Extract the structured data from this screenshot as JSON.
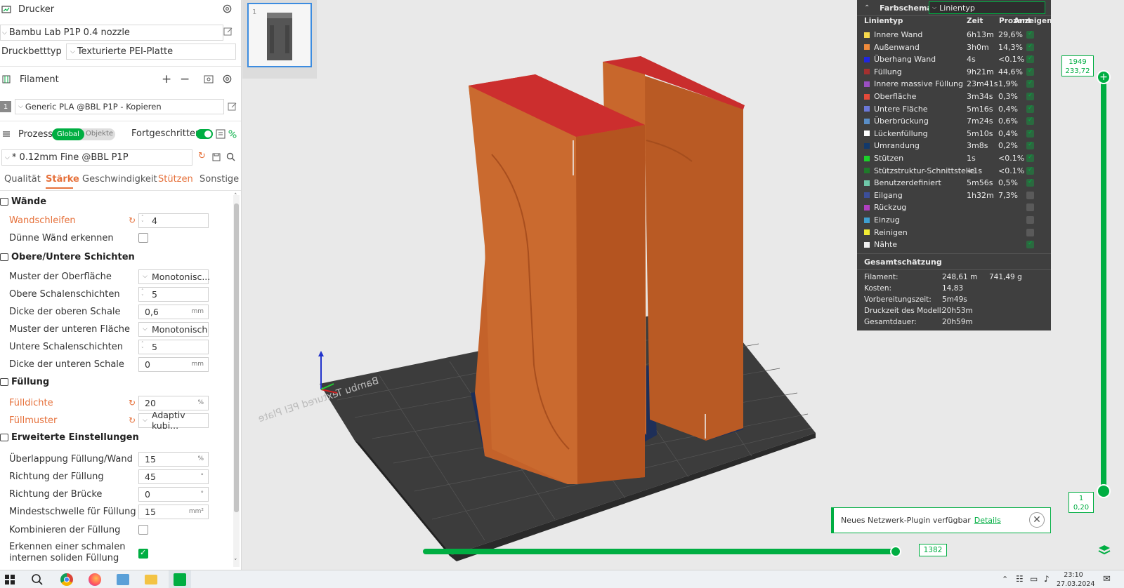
{
  "printer": {
    "section_title": "Drucker",
    "printer_name": "Bambu Lab P1P 0.4 nozzle",
    "bed_type_label": "Druckbetttyp",
    "bed_type_value": "Texturierte PEI-Platte"
  },
  "filament": {
    "section_title": "Filament",
    "slot_number": "1",
    "name": "Generic PLA @BBL P1P - Kopieren"
  },
  "process": {
    "section_title": "Prozess",
    "toggle_global": "Global",
    "toggle_objects": "Objekte",
    "advanced_label": "Fortgeschritten",
    "preset": "* 0.12mm Fine @BBL P1P",
    "tabs": [
      "Qualität",
      "Stärke",
      "Geschwindigkeit",
      "Stützen",
      "Sonstige"
    ],
    "active_tab": "Stärke"
  },
  "settings": {
    "walls_title": "Wände",
    "wall_loops_label": "Wandschleifen",
    "wall_loops_value": "4",
    "thin_walls_label": "Dünne Wänd erkennen",
    "top_bottom_title": "Obere/Untere Schichten",
    "top_pattern_label": "Muster der Oberfläche",
    "top_pattern_value": "Monotonisc...",
    "top_layers_label": "Obere Schalenschichten",
    "top_layers_value": "5",
    "top_thickness_label": "Dicke der oberen Schale",
    "top_thickness_value": "0,6",
    "bottom_pattern_label": "Muster der unteren Fläche",
    "bottom_pattern_value": "Monotonisch",
    "bottom_layers_label": "Untere Schalenschichten",
    "bottom_layers_value": "5",
    "bottom_thickness_label": "Dicke der unteren Schale",
    "bottom_thickness_value": "0",
    "infill_title": "Füllung",
    "infill_density_label": "Fülldichte",
    "infill_density_value": "20",
    "infill_pattern_label": "Füllmuster",
    "infill_pattern_value": "Adaptiv kubi...",
    "advanced_title": "Erweiterte Einstellungen",
    "overlap_label": "Überlappung Füllung/Wand",
    "overlap_value": "15",
    "direction_label": "Richtung der Füllung",
    "direction_value": "45",
    "bridge_label": "Richtung der Brücke",
    "bridge_value": "0",
    "min_threshold_label": "Mindestschwelle für Füllung",
    "min_threshold_value": "15",
    "combine_label": "Kombinieren der Füllung",
    "narrow_label_1": "Erkennen einer schmalen",
    "narrow_label_2": "internen soliden Füllung",
    "unit_mm": "mm",
    "unit_pct": "%",
    "unit_deg": "°",
    "unit_mm2": "mm²"
  },
  "legend": {
    "scheme_title": "Farbschema",
    "scheme_value": "Linientyp",
    "col_type": "Linientyp",
    "col_time": "Zeit",
    "col_pct": "Prozent",
    "col_show": "Anzeigen",
    "rows": [
      {
        "name": "Innere Wand",
        "time": "6h13m",
        "pct": "29,6%",
        "color": "#f7d94c",
        "on": true
      },
      {
        "name": "Außenwand",
        "time": "3h0m",
        "pct": "14,3%",
        "color": "#ef8a3b",
        "on": true
      },
      {
        "name": "Überhang Wand",
        "time": "4s",
        "pct": "<0.1%",
        "color": "#2026e0",
        "on": true
      },
      {
        "name": "Füllung",
        "time": "9h21m",
        "pct": "44,6%",
        "color": "#a4302f",
        "on": true
      },
      {
        "name": "Innere massive Füllung",
        "time": "23m41s",
        "pct": "1,9%",
        "color": "#9a4fc2",
        "on": true
      },
      {
        "name": "Oberfläche",
        "time": "3m34s",
        "pct": "0,3%",
        "color": "#e44a3a",
        "on": true
      },
      {
        "name": "Untere Fläche",
        "time": "5m16s",
        "pct": "0,4%",
        "color": "#6b78d8",
        "on": true
      },
      {
        "name": "Überbrückung",
        "time": "7m24s",
        "pct": "0,6%",
        "color": "#5a8ec7",
        "on": true
      },
      {
        "name": "Lückenfüllung",
        "time": "5m10s",
        "pct": "0,4%",
        "color": "#ffffff",
        "on": true
      },
      {
        "name": "Umrandung",
        "time": "3m8s",
        "pct": "0,2%",
        "color": "#12396b",
        "on": true
      },
      {
        "name": "Stützen",
        "time": "1s",
        "pct": "<0.1%",
        "color": "#1cd12a",
        "on": true
      },
      {
        "name": "Stützstruktur-Schnittstelle",
        "time": "<1s",
        "pct": "<0.1%",
        "color": "#1f7a2a",
        "on": true
      },
      {
        "name": "Benutzerdefiniert",
        "time": "5m56s",
        "pct": "0,5%",
        "color": "#6fc7a8",
        "on": true
      },
      {
        "name": "Eilgang",
        "time": "1h32m",
        "pct": "7,3%",
        "color": "#3c4f9a",
        "on": false
      },
      {
        "name": "Rückzug",
        "time": "",
        "pct": "",
        "color": "#b03fc0",
        "on": false
      },
      {
        "name": "Einzug",
        "time": "",
        "pct": "",
        "color": "#3f9fd0",
        "on": false
      },
      {
        "name": "Reinigen",
        "time": "",
        "pct": "",
        "color": "#f2ec34",
        "on": false
      },
      {
        "name": "Nähte",
        "time": "",
        "pct": "",
        "color": "#f0f0f0",
        "on": true
      }
    ],
    "estimate_title": "Gesamtschätzung",
    "est_filament_label": "Filament:",
    "est_filament_len": "248,61 m",
    "est_filament_weight": "741,49 g",
    "est_cost_label": "Kosten:",
    "est_cost_value": "14,83",
    "est_prep_label": "Vorbereitungszeit:",
    "est_prep_value": "5m49s",
    "est_model_label": "Druckzeit des Modell:",
    "est_model_value": "20h53m",
    "est_total_label": "Gesamtdauer:",
    "est_total_value": "20h59m"
  },
  "sliders": {
    "layer_top": "1949",
    "height_top": "233,72",
    "layer_bottom": "1",
    "height_bottom": "0,20",
    "move_value": "1382"
  },
  "notification": {
    "text": "Neues Netzwerk-Plugin verfügbar",
    "link": "Details"
  },
  "plate_text": "Bambu Textured PEI Plate",
  "taskbar": {
    "time": "23:10",
    "date": "27.03.2024"
  },
  "colors": {
    "accent": "#00ae42",
    "modified": "#e6713b",
    "model": "#c4622a",
    "model_top": "#c42c2c"
  }
}
